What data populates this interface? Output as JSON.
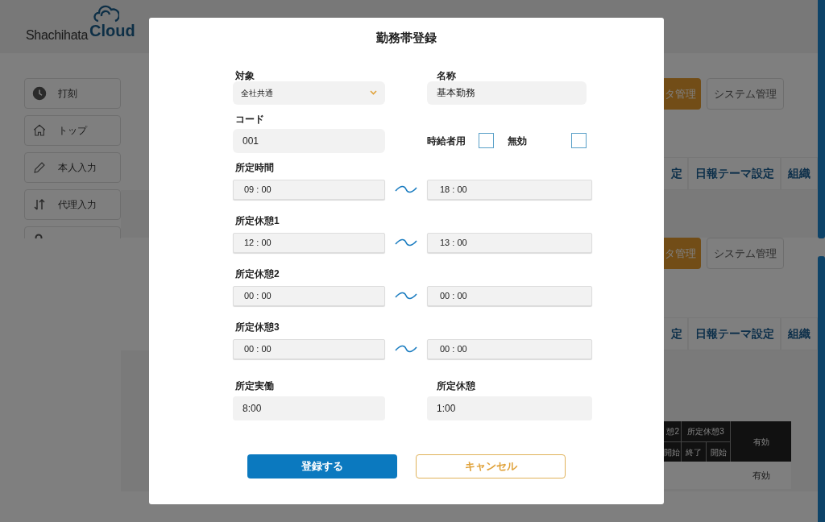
{
  "header": {
    "logo_text": "Shachihata",
    "logo_accent": "Cloud"
  },
  "sidebar": {
    "items": [
      {
        "label": "打刻"
      },
      {
        "label": "トップ"
      },
      {
        "label": "本人入力"
      },
      {
        "label": "代理入力"
      }
    ]
  },
  "sections": [
    {
      "buttons": [
        {
          "label": "タ管理",
          "selected": true
        },
        {
          "label": "システム管理",
          "selected": false
        }
      ],
      "tabs": [
        "定",
        "日報テーマ設定",
        "組織"
      ]
    },
    {
      "buttons": [
        {
          "label": "タ管理",
          "selected": true
        },
        {
          "label": "システム管理",
          "selected": false
        }
      ],
      "tabs": [
        "定",
        "日報テーマ設定",
        "組織"
      ]
    }
  ],
  "table": {
    "group_headers": [
      "憩2",
      "所定休憩3"
    ],
    "valid_header": "有効",
    "sub_headers": [
      "開始",
      "終了",
      "開始"
    ],
    "rows": [
      {
        "valid": "有効"
      }
    ]
  },
  "dialog": {
    "title": "勤務帯登録",
    "target": {
      "label": "対象",
      "value": "全社共通"
    },
    "name": {
      "label": "名称",
      "value": "基本勤務"
    },
    "code": {
      "label": "コード",
      "value": "001"
    },
    "checkboxes": [
      {
        "label": "時給者用",
        "checked": false
      },
      {
        "label": "無効",
        "checked": false
      }
    ],
    "ranges": [
      {
        "label": "所定時間",
        "start": "09 : 00",
        "end": "18 : 00"
      },
      {
        "label": "所定休憩1",
        "start": "12 : 00",
        "end": "13 : 00"
      },
      {
        "label": "所定休憩2",
        "start": "00 : 00",
        "end": "00 : 00"
      },
      {
        "label": "所定休憩3",
        "start": "00 : 00",
        "end": "00 : 00"
      }
    ],
    "totals": [
      {
        "label": "所定実働",
        "value": "8:00"
      },
      {
        "label": "所定休憩",
        "value": "1:00"
      }
    ],
    "buttons": [
      {
        "label": "登録する",
        "kind": "primary"
      },
      {
        "label": "キャンセル",
        "kind": "secondary"
      }
    ]
  }
}
